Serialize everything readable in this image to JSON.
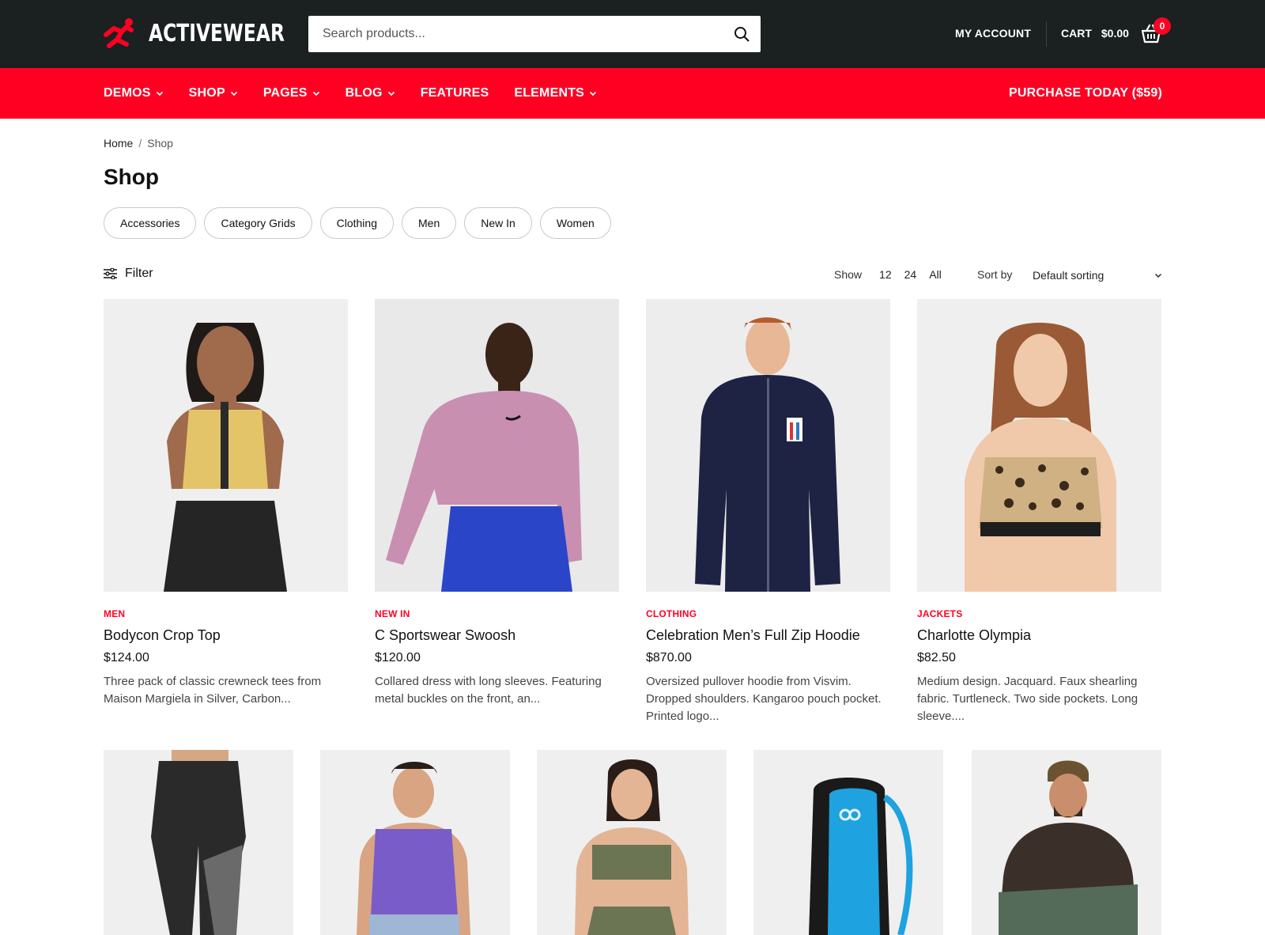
{
  "brand": {
    "name": "ACTIVEWEAR",
    "accent": "#ff0023",
    "dark": "#1b2021"
  },
  "search": {
    "placeholder": "Search products..."
  },
  "header": {
    "account_label": "MY ACCOUNT",
    "cart_label": "CART",
    "cart_total": "$0.00",
    "cart_count": "0"
  },
  "nav": {
    "items": [
      {
        "label": "DEMOS",
        "dropdown": true
      },
      {
        "label": "SHOP",
        "dropdown": true
      },
      {
        "label": "PAGES",
        "dropdown": true
      },
      {
        "label": "BLOG",
        "dropdown": true
      },
      {
        "label": "FEATURES",
        "dropdown": false
      },
      {
        "label": "ELEMENTS",
        "dropdown": true
      }
    ],
    "cta": "PURCHASE TODAY ($59)"
  },
  "breadcrumb": {
    "home": "Home",
    "separator": "/",
    "current": "Shop"
  },
  "page_title": "Shop",
  "categories": [
    "Accessories",
    "Category Grids",
    "Clothing",
    "Men",
    "New In",
    "Women"
  ],
  "toolbar": {
    "filter_label": "Filter",
    "show_label": "Show",
    "show_options": [
      "12",
      "24",
      "All"
    ],
    "sort_label": "Sort by",
    "sort_value": "Default sorting"
  },
  "products": [
    {
      "category": "MEN",
      "name": "Bodycon Crop Top",
      "price": "$124.00",
      "description": "Three pack of classic crewneck tees from Maison Margiela in Silver, Carbon..."
    },
    {
      "category": "NEW IN",
      "name": "C Sportswear Swoosh",
      "price": "$120.00",
      "description": "Collared dress with long sleeves. Featuring metal buckles on the front, an..."
    },
    {
      "category": "CLOTHING",
      "name": "Celebration Men’s Full Zip Hoodie",
      "price": "$870.00",
      "description": "Oversized pullover hoodie from Visvim. Dropped shoulders. Kangaroo pouch pocket. Printed logo..."
    },
    {
      "category": "JACKETS",
      "name": "Charlotte Olympia",
      "price": "$82.50",
      "description": "Medium design. Jacquard. Faux shearling fabric. Turtleneck. Two side pockets. Long sleeve...."
    }
  ]
}
